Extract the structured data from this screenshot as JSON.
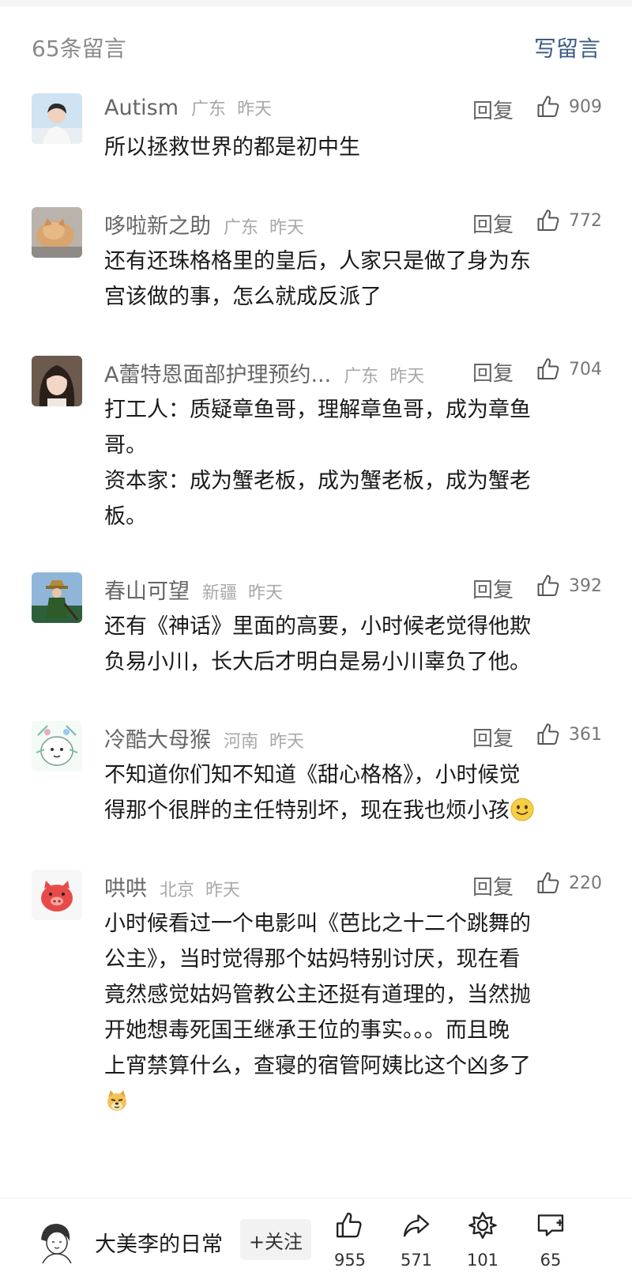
{
  "header": {
    "count_label": "65条留言",
    "write_label": "写留言"
  },
  "comments": [
    {
      "name": "Autism",
      "location": "广东",
      "time": "昨天",
      "reply": "回复",
      "likes": "909",
      "lines": [
        "所以拯救世界的都是初中生"
      ]
    },
    {
      "name": "哆啦新之助",
      "location": "广东",
      "time": "昨天",
      "reply": "回复",
      "likes": "772",
      "lines": [
        "还有还珠格格里的皇后，人家只是做了身为东",
        "宫该做的事，怎么就成反派了"
      ]
    },
    {
      "name": "A蕾特恩面部护理预约...",
      "location": "广东",
      "time": "昨天",
      "reply": "回复",
      "likes": "704",
      "lines": [
        "打工人：质疑章鱼哥，理解章鱼哥，成为章鱼",
        "哥。",
        "资本家：成为蟹老板，成为蟹老板，成为蟹老",
        "板。"
      ]
    },
    {
      "name": "春山可望",
      "location": "新疆",
      "time": "昨天",
      "reply": "回复",
      "likes": "392",
      "lines": [
        "还有《神话》里面的高要，小时候老觉得他欺",
        "负易小川，长大后才明白是易小川辜负了他。"
      ]
    },
    {
      "name": "冷酷大母猴",
      "location": "河南",
      "time": "昨天",
      "reply": "回复",
      "likes": "361",
      "lines": [
        "不知道你们知不知道《甜心格格》，小时候觉",
        "得那个很胖的主任特别坏，现在我也烦小孩"
      ]
    },
    {
      "name": "哄哄",
      "location": "北京",
      "time": "昨天",
      "reply": "回复",
      "likes": "220",
      "lines": [
        "小时候看过一个电影叫《芭比之十二个跳舞的",
        "公主》，当时觉得那个姑妈特别讨厌，现在看",
        "竟然感觉姑妈管教公主还挺有道理的，当然抛",
        "开她想毒死国王继承王位的事实。。。而且晚",
        "上宵禁算什么，查寝的宿管阿姨比这个凶多了"
      ]
    }
  ],
  "bottom": {
    "author_name": "大美李的日常",
    "follow_label": "+关注",
    "like_count": "955",
    "share_count": "571",
    "recommend_count": "101",
    "comment_count": "65"
  },
  "colors": {
    "link": "#3f5d85",
    "muted": "#a8a8a8"
  },
  "icons": [
    "thumbs-up-icon",
    "share-icon",
    "recommend-icon",
    "comment-icon",
    "smile-emoji",
    "doge-emoji"
  ]
}
